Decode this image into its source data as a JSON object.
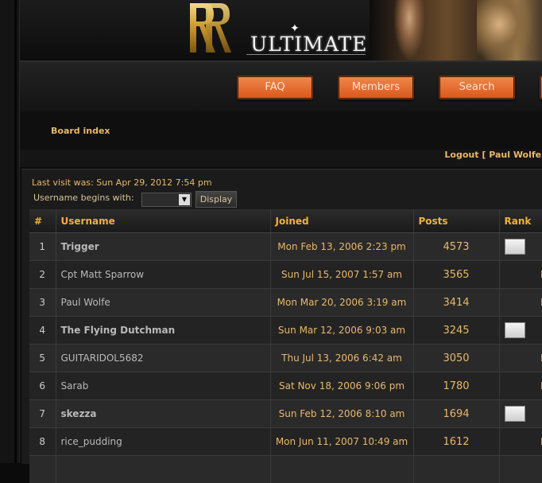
{
  "site": {
    "logo_text": "ULTIMATE"
  },
  "nav": {
    "faq": "FAQ",
    "members": "Members",
    "search": "Search"
  },
  "breadcrumb": {
    "board_index": "Board index"
  },
  "user": {
    "logout": "Logout [ Paul Wolfe ]"
  },
  "memberlist": {
    "last_visit": "Last visit was: Sun Apr 29, 2012 7:54 pm",
    "filter_label": "Username begins with:",
    "filter_value": "",
    "display_label": "Display",
    "columns": {
      "num": "#",
      "username": "Username",
      "joined": "Joined",
      "posts": "Posts",
      "rank": "Rank"
    },
    "rows": [
      {
        "num": "1",
        "username": "Trigger",
        "joined": "Mon Feb 13, 2006 2:23 pm",
        "posts": "4573",
        "rank": "",
        "rank_icon": "rank-image",
        "name_color": "#c01010"
      },
      {
        "num": "2",
        "username": "Cpt Matt Sparrow",
        "joined": "Sun Jul 15, 2007 1:57 am",
        "posts": "3565",
        "rank": "M"
      },
      {
        "num": "3",
        "username": "Paul Wolfe",
        "joined": "Mon Mar 20, 2006 3:19 am",
        "posts": "3414",
        "rank": "M"
      },
      {
        "num": "4",
        "username": "The Flying Dutchman",
        "joined": "Sun Mar 12, 2006 9:03 am",
        "posts": "3245",
        "rank": "",
        "rank_icon": "rank-image",
        "name_color": "#22aa22"
      },
      {
        "num": "5",
        "username": "GUITARIDOL5682",
        "joined": "Thu Jul 13, 2006 6:42 am",
        "posts": "3050",
        "rank": "M"
      },
      {
        "num": "6",
        "username": "Sarab",
        "joined": "Sat Nov 18, 2006 9:06 pm",
        "posts": "1780",
        "rank": "M"
      },
      {
        "num": "7",
        "username": "skezza",
        "joined": "Sun Feb 12, 2006 8:10 am",
        "posts": "1694",
        "rank": "",
        "rank_icon": "rank-image",
        "name_color": "#c01010"
      },
      {
        "num": "8",
        "username": "rice_pudding",
        "joined": "Mon Jun 11, 2007 10:49 am",
        "posts": "1612",
        "rank": "M"
      }
    ]
  }
}
